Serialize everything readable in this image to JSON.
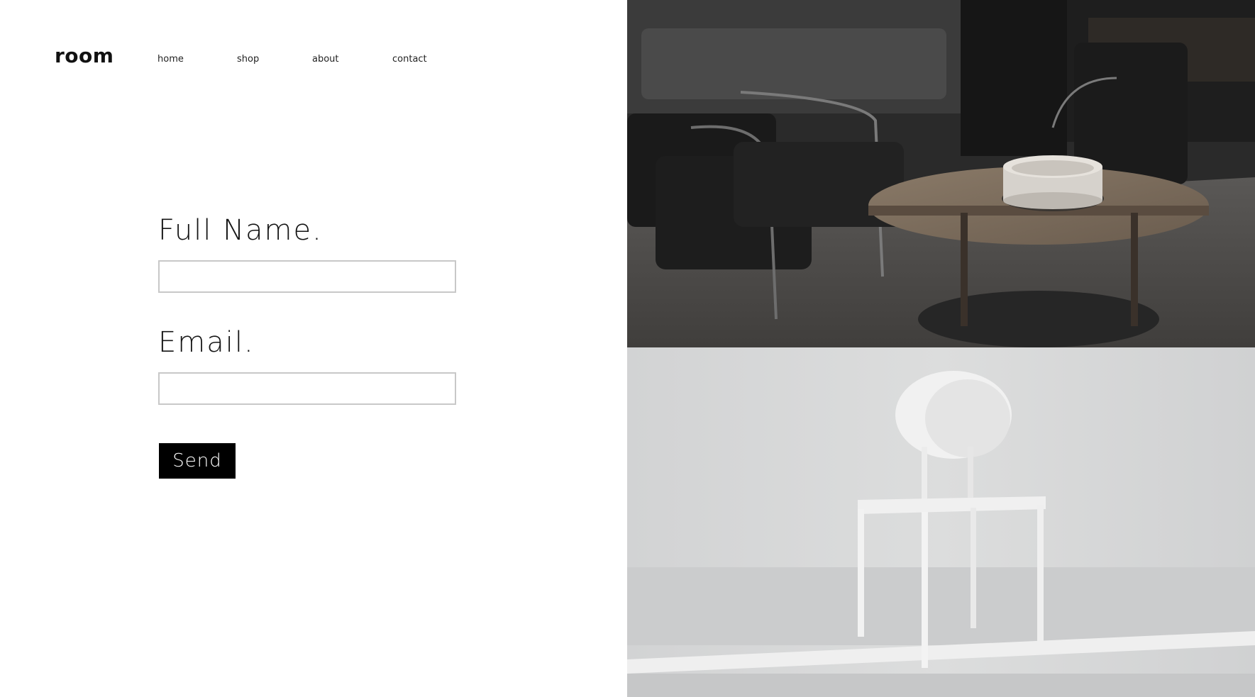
{
  "brand": {
    "logo_text": "room"
  },
  "nav": {
    "items": [
      {
        "label": "home"
      },
      {
        "label": "shop"
      },
      {
        "label": "about"
      },
      {
        "label": "contact"
      }
    ]
  },
  "form": {
    "full_name": {
      "label": "Full Name.",
      "value": "",
      "placeholder": ""
    },
    "email": {
      "label": "Email.",
      "value": "",
      "placeholder": ""
    },
    "submit_label": "Send"
  },
  "images": {
    "top": {
      "subject": "dark-lounge-armchairs-and-coffee-table-photo"
    },
    "bottom": {
      "subject": "white-chair-photo"
    }
  },
  "colors": {
    "text": "#151515",
    "button_bg": "#000000",
    "button_text": "#ffffff",
    "input_border": "#c8c8c8"
  }
}
